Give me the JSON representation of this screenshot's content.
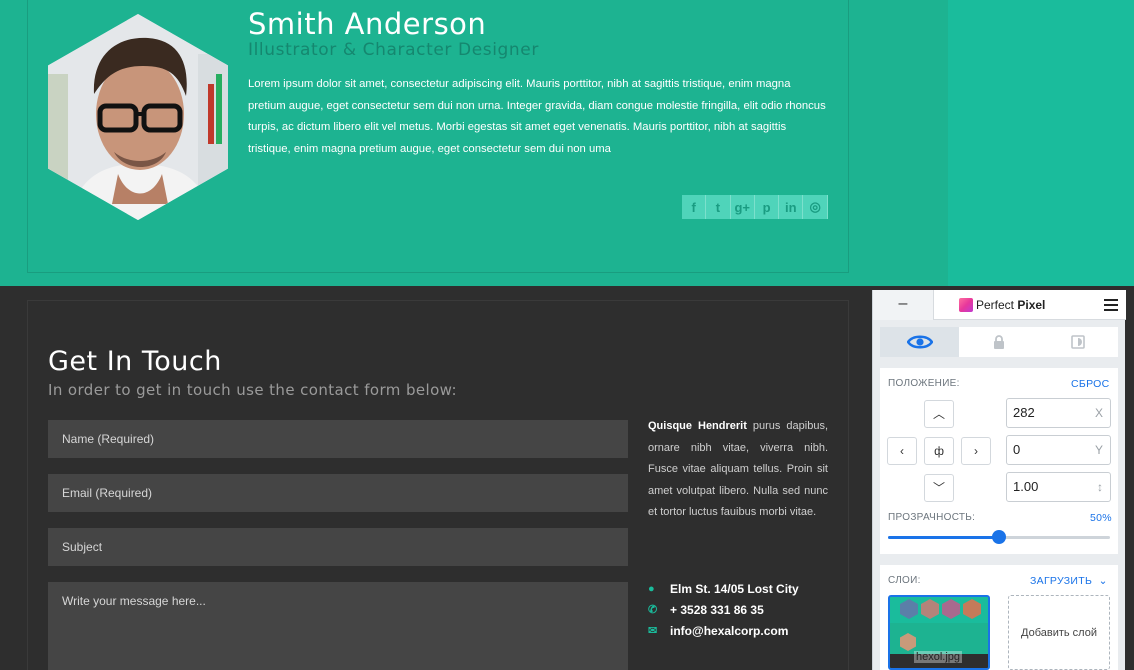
{
  "profile": {
    "name": "Smith Anderson",
    "role": "Illustrator & Character Designer",
    "bio": "Lorem ipsum dolor sit amet, consectetur adipiscing elit. Mauris porttitor, nibh at sagittis tristique, enim magna pretium augue, eget consectetur sem dui non urna. Integer gravida, diam congue molestie fringilla, elit odio rhoncus turpis, ac dictum libero elit vel metus. Morbi egestas sit amet eget venenatis. Mauris porttitor, nibh at sagittis tristique, enim magna pretium augue, eget consectetur sem dui non uma",
    "social_icons": [
      "facebook-icon",
      "twitter-icon",
      "google-plus-icon",
      "pinterest-icon",
      "linkedin-icon",
      "dribbble-icon"
    ],
    "social_glyphs": [
      "f",
      "t",
      "g+",
      "p",
      "in",
      "◎"
    ]
  },
  "contact": {
    "title": "Get In Touch",
    "subtitle": "In order to get in touch use the contact form below:",
    "fields": {
      "name": "Name (Required)",
      "email": "Email (Required)",
      "subject": "Subject",
      "message": "Write your message here..."
    },
    "info_lead": "Quisque Hendrerit",
    "info_text": "purus dapibus, ornare nibh vitae, viverra nibh. Fusce vitae aliquam tellus. Proin sit amet volutpat libero. Nulla sed nunc et tortor luctus fauibus morbi vitae.",
    "address": "Elm St. 14/05 Lost City",
    "phone": "+ 3528 331 86 35",
    "email": "info@hexalcorp.com"
  },
  "perfect_pixel": {
    "minimize": "–",
    "title_a": "Perfect",
    "title_b": "Pixel",
    "position_label": "ПОЛОЖЕНИЕ:",
    "reset_label": "СБРОС",
    "x_value": "282",
    "x_axis": "X",
    "y_value": "0",
    "y_axis": "Y",
    "scale_value": "1.00",
    "scale_axis": "↕",
    "center_glyph": "ф",
    "opacity_label": "ПРОЗРАЧНОСТЬ:",
    "opacity_value": "50%",
    "opacity_fraction": 0.5,
    "layers_label": "СЛОИ:",
    "upload_label": "ЗАГРУЗИТЬ",
    "layer_file": "hexol.jpg",
    "add_layer": "Добавить слой",
    "accent": "#1a73e8"
  }
}
